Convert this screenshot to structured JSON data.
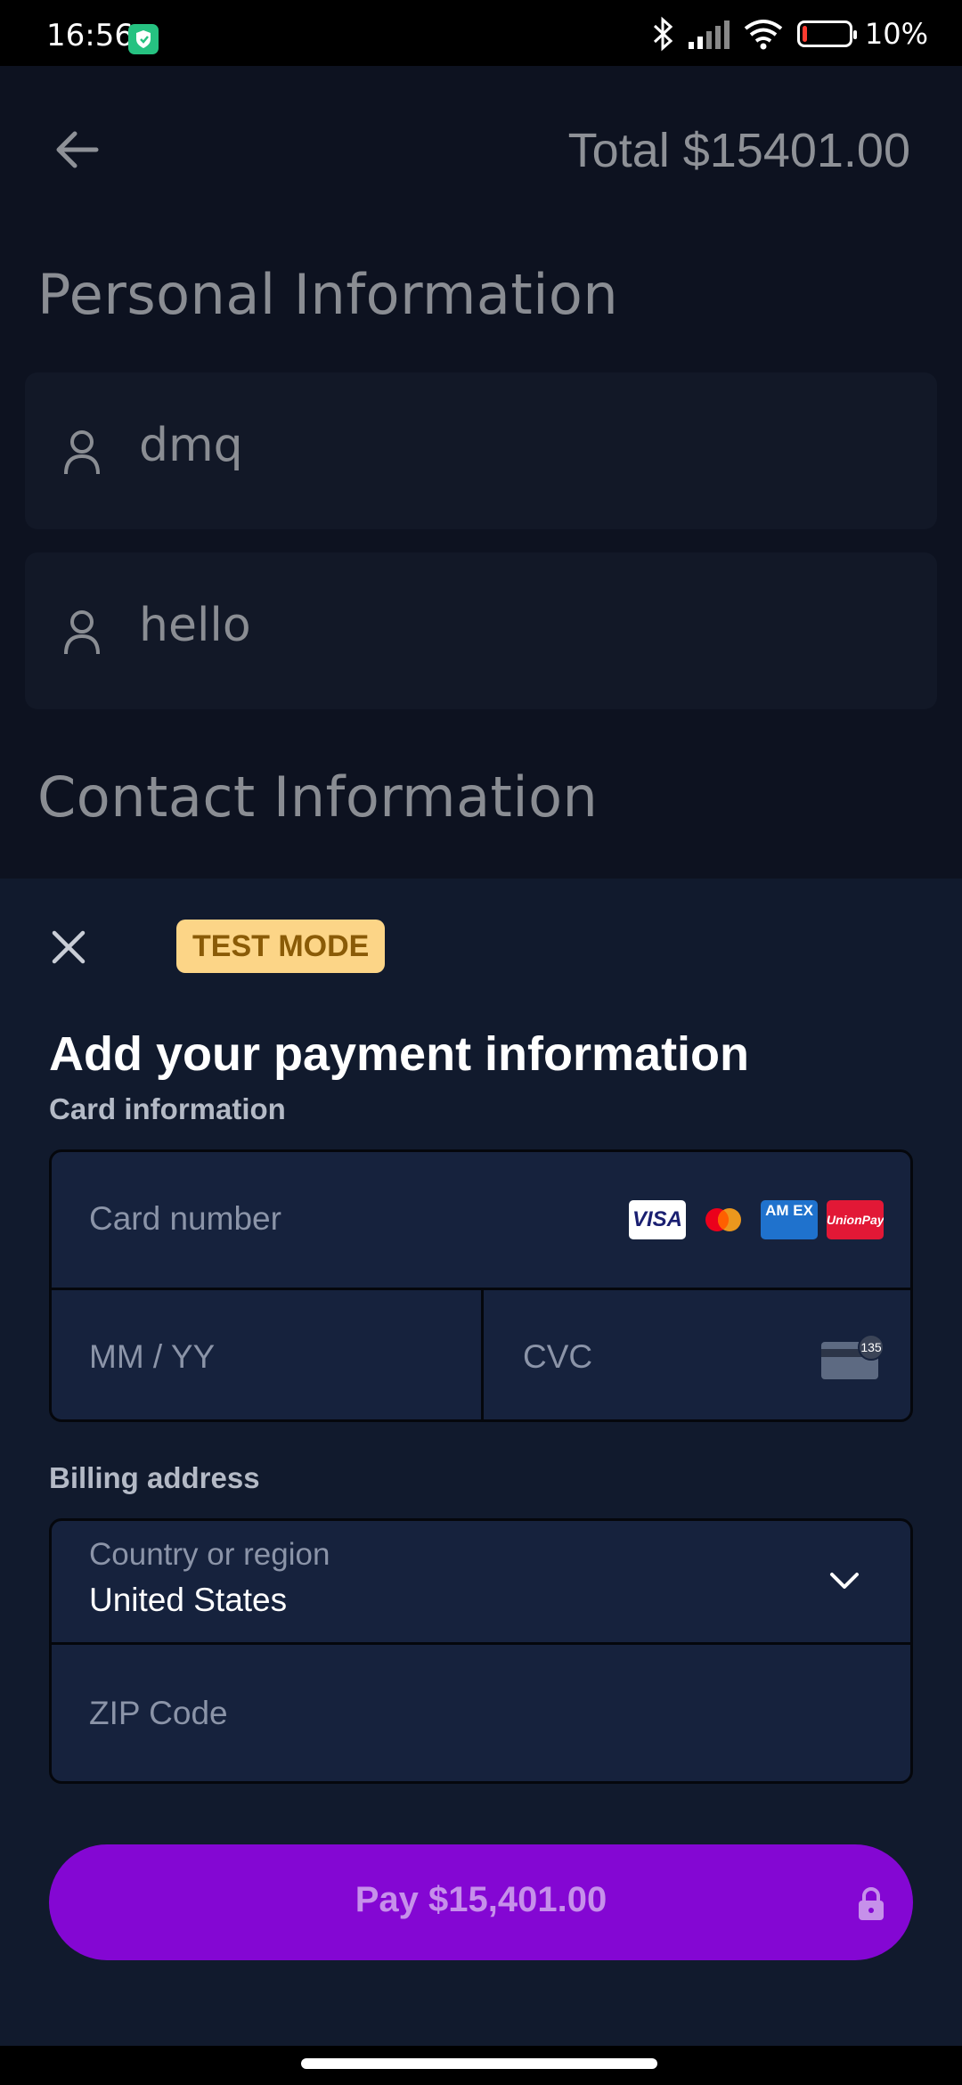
{
  "status_bar": {
    "time": "16:56",
    "battery_text": "10%",
    "battery_level_percent": 10,
    "icons": [
      "shield-app-icon",
      "bluetooth-icon",
      "signal-icon",
      "wifi-icon",
      "battery-icon"
    ]
  },
  "header": {
    "total": "Total $15401.00"
  },
  "personal": {
    "title": "Personal Information",
    "first_name": "dmq",
    "last_name": "hello"
  },
  "contact": {
    "title": "Contact Information"
  },
  "payment_sheet": {
    "badge": "TEST MODE",
    "title": "Add your payment information",
    "card_label": "Card information",
    "card_number_placeholder": "Card number",
    "expiry_placeholder": "MM / YY",
    "cvc_placeholder": "CVC",
    "cvc_hint": "135",
    "brands": {
      "visa": "VISA",
      "amex": "AM EX",
      "unionpay": "UnionPay"
    },
    "billing_label": "Billing address",
    "country_label": "Country or region",
    "country_value": "United States",
    "zip_placeholder": "ZIP Code",
    "pay_button": "Pay $15,401.00"
  },
  "colors": {
    "pay_button": "#8407d3",
    "badge_bg": "#fcd587",
    "sheet_bg": "#111a2d",
    "field_bg": "#16223d"
  }
}
